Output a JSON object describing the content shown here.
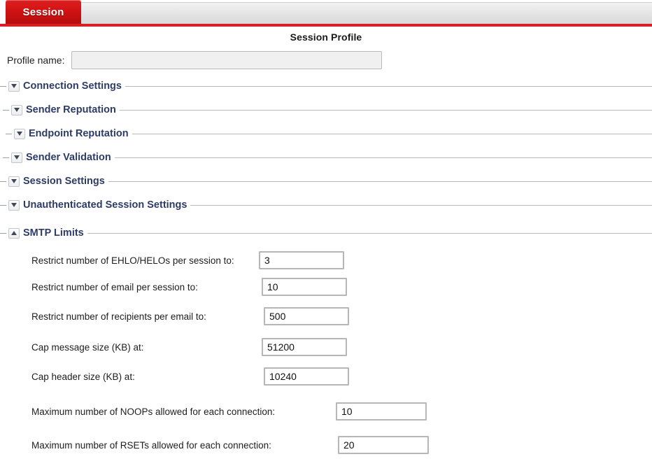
{
  "tabs": {
    "active_label": "Session"
  },
  "header": {
    "title": "Session Profile"
  },
  "profile": {
    "label": "Profile name:",
    "value": "",
    "placeholder": ""
  },
  "sections": [
    {
      "label": "Connection Settings",
      "state": "collapsed",
      "icon": "chevron-down-icon"
    },
    {
      "label": "Sender Reputation",
      "state": "collapsed",
      "icon": "chevron-down-icon"
    },
    {
      "label": "Endpoint Reputation",
      "state": "collapsed",
      "icon": "chevron-down-icon"
    },
    {
      "label": "Sender Validation",
      "state": "collapsed",
      "icon": "chevron-down-icon"
    },
    {
      "label": "Session Settings",
      "state": "collapsed",
      "icon": "chevron-down-icon"
    },
    {
      "label": "Unauthenticated Session Settings",
      "state": "collapsed",
      "icon": "chevron-down-icon"
    },
    {
      "label": "SMTP Limits",
      "state": "expanded",
      "icon": "chevron-up-icon"
    }
  ],
  "smtp_limits": {
    "fields": [
      {
        "label": "Restrict number of EHLO/HELOs per session to:",
        "value": "3"
      },
      {
        "label": "Restrict number of email per session to:",
        "value": "10"
      },
      {
        "label": "Restrict number of recipients per email to:",
        "value": "500"
      },
      {
        "label": "Cap message size (KB) at:",
        "value": "51200"
      },
      {
        "label": "Cap header size (KB) at:",
        "value": "10240"
      },
      {
        "label": "Maximum number of NOOPs allowed for each connection:",
        "value": "10"
      },
      {
        "label": "Maximum number of RSETs allowed for each connection:",
        "value": "20"
      }
    ]
  },
  "colors": {
    "tab_active": "#cf1212",
    "rule_red": "#d81f26",
    "section_title": "#2d3c66",
    "section_line": "#b6b9be",
    "input_border": "#b6b6b6"
  }
}
